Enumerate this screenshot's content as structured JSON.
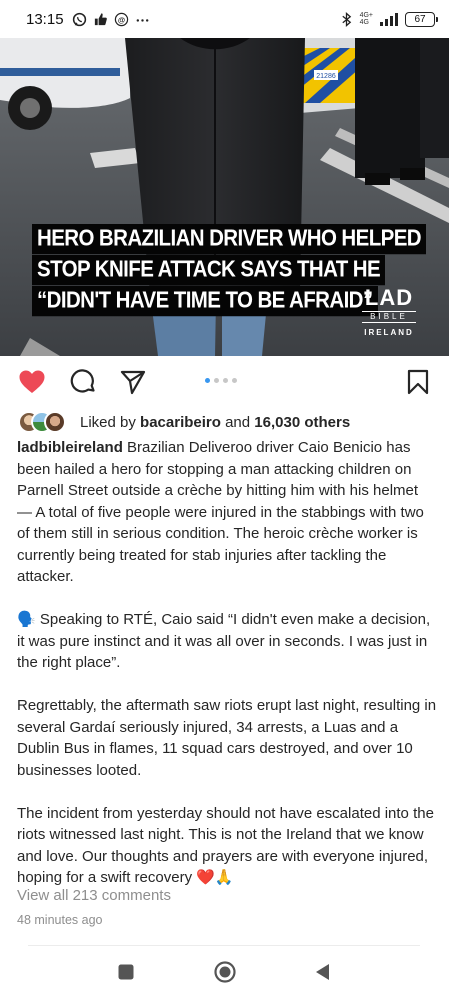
{
  "status_bar": {
    "time": "13:15",
    "network_top": "4G+",
    "network_bottom": "4G",
    "battery": "67"
  },
  "post_image": {
    "headline_lines": [
      "HERO BRAZILIAN DRIVER WHO HELPED",
      "STOP KNIFE ATTACK SAYS THAT HE",
      "“DIDN'T HAVE TIME TO BE AFRAID”"
    ],
    "logo": {
      "line1": "LAD",
      "line2": "BIBLE",
      "line3": "IRELAND"
    },
    "vehicle_number": "21286"
  },
  "actions": {
    "icons": [
      "heart-icon",
      "comment-icon",
      "share-icon",
      "bookmark-icon"
    ],
    "carousel_count": 4,
    "carousel_active": 1,
    "liked": true,
    "like_color": "#ed4956"
  },
  "likes": {
    "prefix": "Liked by ",
    "user": "bacaribeiro",
    "middle": " and ",
    "count": "16,030 others"
  },
  "caption": {
    "username": "ladbibleireland",
    "paragraph1": " Brazilian Deliveroo driver Caio Benicio has been hailed a hero for stopping a man attacking children on Parnell Street outside a crèche by hitting him with his helmet — A total of five people were injured in the stabbings with two of them still in serious condition. The heroic crèche worker is currently being treated for stab injuries after tackling the attacker.",
    "paragraph2_emoji": "🗣️",
    "paragraph2": " Speaking to RTÉ, Caio said “I didn't even make a decision, it was pure instinct and it was all over in seconds. I was just in the right place”.",
    "paragraph3": "Regrettably, the aftermath saw riots erupt last night, resulting in several Gardaí seriously injured, 34 arrests, a Luas and a Dublin Bus in flames, 11 squad cars destroyed, and over 10 businesses looted.",
    "paragraph4": "The incident from yesterday should not have escalated into the riots witnessed last night. This is not the Ireland that we know and love. Our thoughts and prayers are with everyone injured, hoping for a swift recovery ",
    "paragraph4_emoji": "❤️🙏"
  },
  "comments_link": "View all 213 comments",
  "timestamp": "48 minutes ago",
  "nav": {
    "icons": [
      "recents-icon",
      "home-icon",
      "back-icon"
    ]
  }
}
